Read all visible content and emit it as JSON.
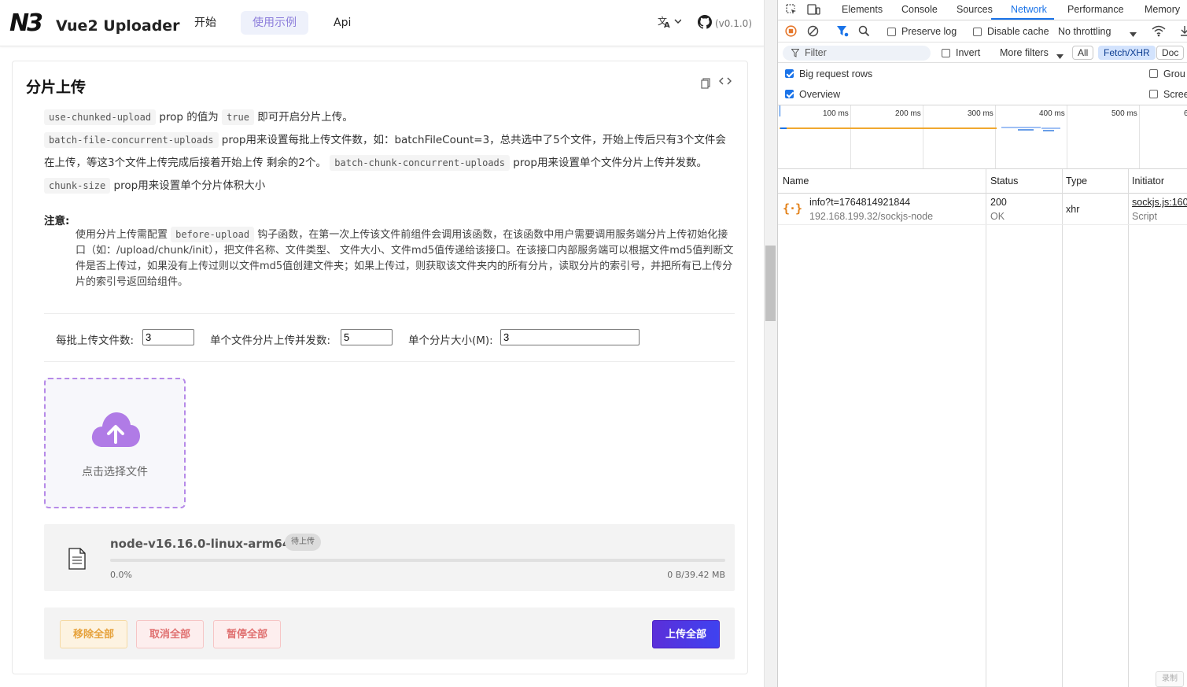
{
  "app": {
    "logo": "N3",
    "brand": "Vue2 Uploader",
    "nav": [
      "开始",
      "使用示例",
      "Api"
    ],
    "active_nav": "使用示例",
    "version": "(v0.1.0)",
    "accent": "#8c7ddb"
  },
  "section": {
    "title": "分片上传",
    "p1": {
      "code1": "use-chunked-upload",
      "t1": " prop 的值为 ",
      "code2": "true",
      "t2": " 即可开启分片上传。"
    },
    "p2": {
      "code1": "batch-file-concurrent-uploads",
      "t1": " prop用来设置每批上传文件数，如：batchFileCount=3，总共选中了5个文件，开始上传后只有3个文件会在上传，等这3个文件上传完成后接着开始上传 剩余的2个。 ",
      "code2": "batch-chunk-concurrent-uploads",
      "t2": " prop用来设置单个文件分片上传并发数。"
    },
    "p3": {
      "code1": "chunk-size",
      "t1": " prop用来设置单个分片体积大小"
    },
    "note_title": "注意:",
    "note": {
      "t1": "使用分片上传需配置 ",
      "code": "before-upload",
      "t2": " 钩子函数，在第一次上传该文件前组件会调用该函数，在该函数中用户需要调用服务端分片上传初始化接口（如：/upload/chunk/init），把文件名称、文件类型、 文件大小、文件md5值传递给该接口。在该接口内部服务端可以根据文件md5值判断文件是否上传过，如果没有上传过则以文件md5值创建文件夹；如果上传过，则获取该文件夹内的所有分片，读取分片的索引号，并把所有已上传分片的索引号返回给组件。"
    }
  },
  "form": {
    "batch_label": "每批上传文件数:",
    "batch_value": "3",
    "chunk_concurrent_label": "单个文件分片上传并发数:",
    "chunk_concurrent_value": "5",
    "chunk_size_label": "单个分片大小(M):",
    "chunk_size_value": "3"
  },
  "dropzone": {
    "label": "点击选择文件",
    "icon": "cloud-upload-icon"
  },
  "file": {
    "name": "node-v16.16.0-linux-arm64",
    "status": "待上传",
    "progress_text": "0.0%",
    "progress": 0,
    "size_text": "0 B/39.42 MB"
  },
  "actions": {
    "remove_all": "移除全部",
    "cancel_all": "取消全部",
    "pause_all": "暂停全部",
    "upload_all": "上传全部"
  },
  "devtools": {
    "tabs": [
      "Elements",
      "Console",
      "Sources",
      "Network",
      "Performance",
      "Memory"
    ],
    "active_tab": "Network",
    "preserve_log": "Preserve log",
    "disable_cache": "Disable cache",
    "throttling": "No throttling",
    "filter_placeholder": "Filter",
    "invert": "Invert",
    "more_filters": "More filters",
    "chips": [
      "All",
      "Fetch/XHR",
      "Doc"
    ],
    "active_chip": "Fetch/XHR",
    "big_rows": "Big request rows",
    "overview": "Overview",
    "group": "Grou",
    "screenshots": "Scree",
    "ticks": [
      "100 ms",
      "200 ms",
      "300 ms",
      "400 ms",
      "500 ms",
      "6"
    ],
    "columns": [
      "Name",
      "Status",
      "Type",
      "Initiator"
    ],
    "requests": [
      {
        "name": "info?t=1764814921844",
        "host": "192.168.199.32/sockjs-node",
        "status": "200",
        "status_text": "OK",
        "type": "xhr",
        "initiator": "sockjs.js:160",
        "initiator_type": "Script"
      }
    ],
    "record_btn": "录制",
    "accent": "#1a73e8"
  }
}
